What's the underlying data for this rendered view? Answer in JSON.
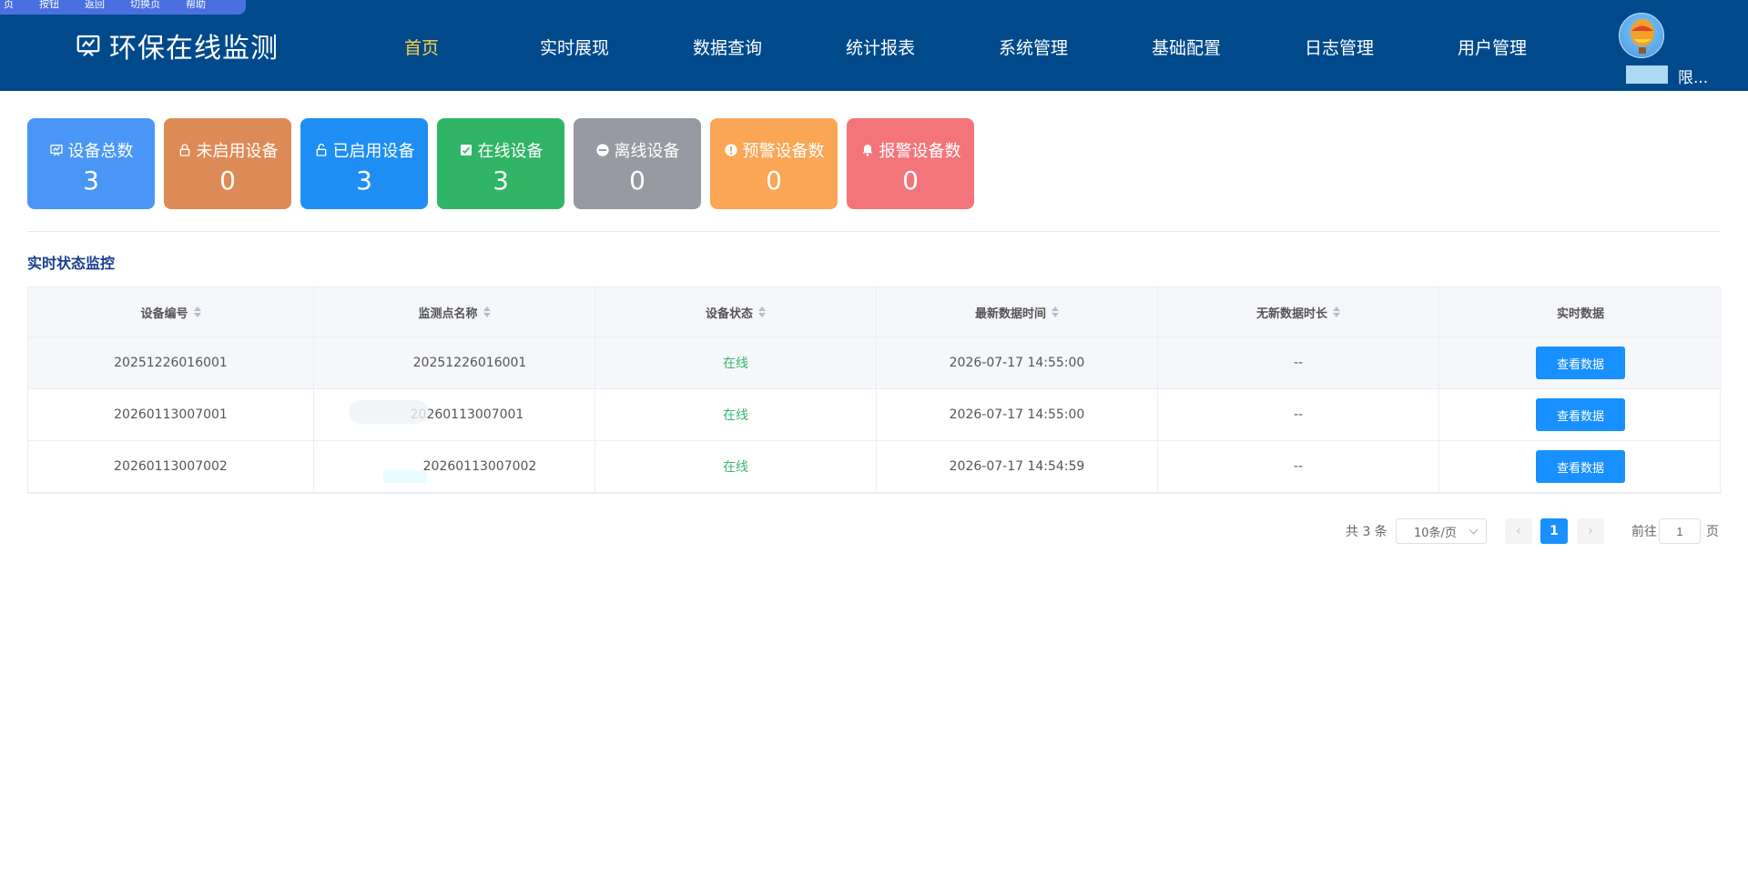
{
  "mini_bar": {
    "items": [
      "页",
      "按钮",
      "返回",
      "切换页",
      "帮助"
    ]
  },
  "header": {
    "app_title": "环保在线监测",
    "nav": [
      {
        "label": "首页",
        "active": true
      },
      {
        "label": "实时展现",
        "active": false
      },
      {
        "label": "数据查询",
        "active": false
      },
      {
        "label": "统计报表",
        "active": false
      },
      {
        "label": "系统管理",
        "active": false
      },
      {
        "label": "基础配置",
        "active": false
      },
      {
        "label": "日志管理",
        "active": false
      },
      {
        "label": "用户管理",
        "active": false
      }
    ],
    "user_name": "限..."
  },
  "stats": [
    {
      "label": "设备总数",
      "value": "3",
      "color": "#4a96f7",
      "icon": "monitor-icon"
    },
    {
      "label": "未启用设备",
      "value": "0",
      "color": "#dc8b57",
      "icon": "lock-icon"
    },
    {
      "label": "已启用设备",
      "value": "3",
      "color": "#1e8ef5",
      "icon": "unlock-icon"
    },
    {
      "label": "在线设备",
      "value": "3",
      "color": "#2fb565",
      "icon": "check-square-icon"
    },
    {
      "label": "离线设备",
      "value": "0",
      "color": "#979aa2",
      "icon": "minus-circle-icon"
    },
    {
      "label": "预警设备数",
      "value": "0",
      "color": "#fba655",
      "icon": "warning-circle-icon"
    },
    {
      "label": "报警设备数",
      "value": "0",
      "color": "#f47579",
      "icon": "bell-icon"
    }
  ],
  "section_title": "实时状态监控",
  "table": {
    "columns": [
      "设备编号",
      "监测点名称",
      "设备状态",
      "最新数据时间",
      "无新数据时长",
      "实时数据"
    ],
    "rows": [
      {
        "device_id": "20251226016001",
        "point_name": "20251226016001",
        "status": "在线",
        "last_time": "2026-07-17 14:55:00",
        "no_data_duration": "--",
        "action": "查看数据"
      },
      {
        "device_id": "20260113007001",
        "point_name": "20260113007001",
        "status": "在线",
        "last_time": "2026-07-17 14:55:00",
        "no_data_duration": "--",
        "action": "查看数据"
      },
      {
        "device_id": "20260113007002",
        "point_name": "20260113007002",
        "status": "在线",
        "last_time": "2026-07-17 14:54:59",
        "no_data_duration": "--",
        "action": "查看数据"
      }
    ]
  },
  "pagination": {
    "total_text": "共 3 条",
    "page_size": "10条/页",
    "current_page": "1",
    "goto_label": "前往",
    "goto_value": "1",
    "goto_suffix": "页"
  },
  "colors": {
    "header_bg": "#004a8c",
    "nav_active": "#ffd04b",
    "primary": "#1890ff",
    "online": "#3cb371"
  }
}
